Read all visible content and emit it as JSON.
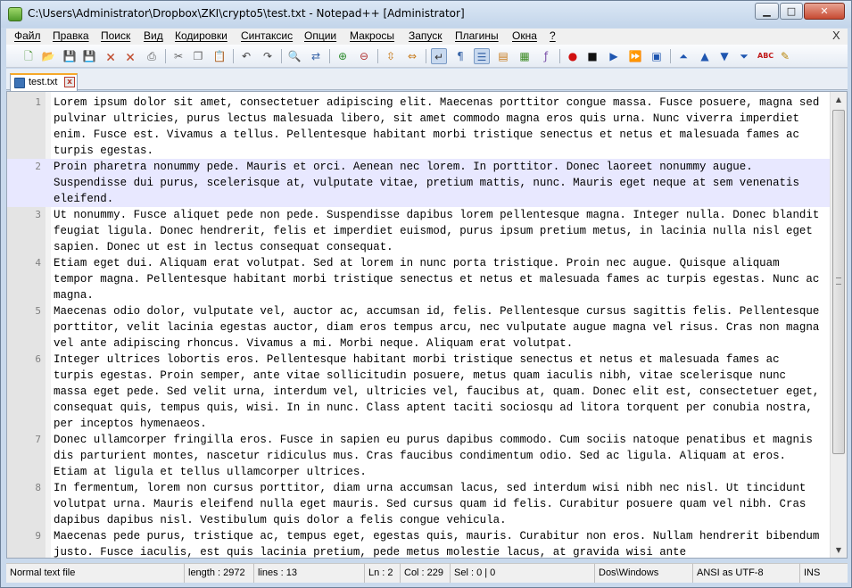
{
  "window": {
    "title": "C:\\Users\\Administrator\\Dropbox\\ZKI\\crypto5\\test.txt - Notepad++ [Administrator]",
    "minimize_label": "▁",
    "maximize_label": "□",
    "close_label": "✕"
  },
  "menu": {
    "items": [
      "Файл",
      "Правка",
      "Поиск",
      "Вид",
      "Кодировки",
      "Синтаксис",
      "Опции",
      "Макросы",
      "Запуск",
      "Плагины",
      "Окна",
      "?"
    ],
    "close_label": "X"
  },
  "toolbar": {
    "buttons": [
      "new-file",
      "open-file",
      "save",
      "save-all",
      "close",
      "close-all",
      "print",
      "cut",
      "copy",
      "paste",
      "undo",
      "redo",
      "find",
      "replace",
      "zoom-in",
      "zoom-out",
      "sync-vertical",
      "sync-horizontal",
      "word-wrap",
      "show-all-chars",
      "indent-guide",
      "user-defined-lang",
      "doc-map",
      "function-list",
      "record-macro",
      "stop-record",
      "play-macro",
      "run-macro-multiple",
      "save-macro",
      "move-up",
      "prev-bookmark",
      "next-bookmark",
      "move-down",
      "spell-check",
      "trim"
    ]
  },
  "tab": {
    "label": "test.txt",
    "close_label": "x"
  },
  "editor": {
    "current_line": 2,
    "lines": [
      {
        "num": "1",
        "text": "Lorem ipsum dolor sit amet, consectetuer adipiscing elit. Maecenas porttitor congue massa. Fusce posuere, magna sed pulvinar ultricies, purus lectus malesuada libero, sit amet commodo magna eros quis urna. Nunc viverra imperdiet enim. Fusce est. Vivamus a tellus. Pellentesque habitant morbi tristique senectus et netus et malesuada fames ac turpis egestas."
      },
      {
        "num": "2",
        "text": "Proin pharetra nonummy pede. Mauris et orci. Aenean nec lorem. In porttitor. Donec laoreet nonummy augue. Suspendisse dui purus, scelerisque at, vulputate vitae, pretium mattis, nunc. Mauris eget neque at sem venenatis eleifend."
      },
      {
        "num": "3",
        "text": "Ut nonummy. Fusce aliquet pede non pede. Suspendisse dapibus lorem pellentesque magna. Integer nulla. Donec blandit feugiat ligula. Donec hendrerit, felis et imperdiet euismod, purus ipsum pretium metus, in lacinia nulla nisl eget sapien. Donec ut est in lectus consequat consequat."
      },
      {
        "num": "4",
        "text": "Etiam eget dui. Aliquam erat volutpat. Sed at lorem in nunc porta tristique. Proin nec augue. Quisque aliquam tempor magna. Pellentesque habitant morbi tristique senectus et netus et malesuada fames ac turpis egestas. Nunc ac magna."
      },
      {
        "num": "5",
        "text": "Maecenas odio dolor, vulputate vel, auctor ac, accumsan id, felis. Pellentesque cursus sagittis felis. Pellentesque porttitor, velit lacinia egestas auctor, diam eros tempus arcu, nec vulputate augue magna vel risus. Cras non magna vel ante adipiscing rhoncus. Vivamus a mi. Morbi neque. Aliquam erat volutpat."
      },
      {
        "num": "6",
        "text": "Integer ultrices lobortis eros. Pellentesque habitant morbi tristique senectus et netus et malesuada fames ac turpis egestas. Proin semper, ante vitae sollicitudin posuere, metus quam iaculis nibh, vitae scelerisque nunc massa eget pede. Sed velit urna, interdum vel, ultricies vel, faucibus at, quam. Donec elit est, consectetuer eget, consequat quis, tempus quis, wisi. In in nunc. Class aptent taciti sociosqu ad litora torquent per conubia nostra, per inceptos hymenaeos."
      },
      {
        "num": "7",
        "text": "Donec ullamcorper fringilla eros. Fusce in sapien eu purus dapibus commodo. Cum sociis natoque penatibus et magnis dis parturient montes, nascetur ridiculus mus. Cras faucibus condimentum odio. Sed ac ligula. Aliquam at eros. Etiam at ligula et tellus ullamcorper ultrices."
      },
      {
        "num": "8",
        "text": "In fermentum, lorem non cursus porttitor, diam urna accumsan lacus, sed interdum wisi nibh nec nisl. Ut tincidunt volutpat urna. Mauris eleifend nulla eget mauris. Sed cursus quam id felis. Curabitur posuere quam vel nibh. Cras dapibus dapibus nisl. Vestibulum quis dolor a felis congue vehicula."
      },
      {
        "num": "9",
        "text": "Maecenas pede purus, tristique ac, tempus eget, egestas quis, mauris. Curabitur non eros. Nullam hendrerit bibendum justo. Fusce iaculis, est quis lacinia pretium, pede metus molestie lacus, at gravida wisi ante"
      }
    ]
  },
  "status": {
    "file_type": "Normal text file",
    "length": "length : 2972",
    "lines": "lines : 13",
    "ln": "Ln : 2",
    "col": "Col : 229",
    "sel": "Sel : 0 | 0",
    "eol": "Dos\\Windows",
    "encoding": "ANSI as UTF-8",
    "mode": "INS"
  }
}
